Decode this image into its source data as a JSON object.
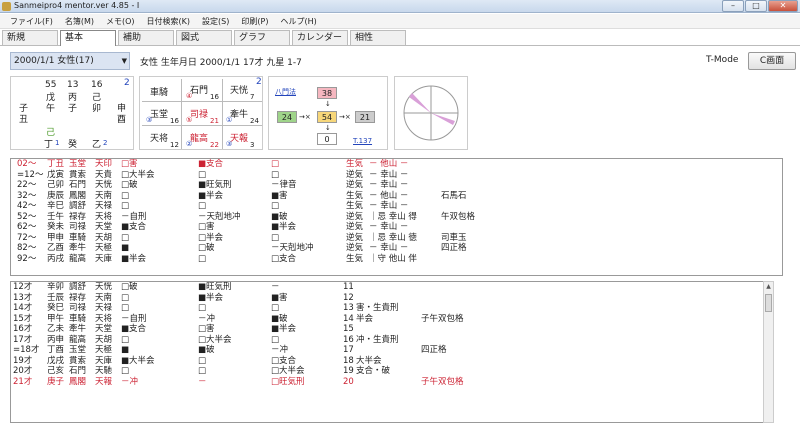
{
  "window": {
    "title": "Sanmeipro4 mentor.ver 4.85 - I"
  },
  "menu": [
    "ファイル(F)",
    "名簿(M)",
    "メモ(O)",
    "日付検索(K)",
    "設定(S)",
    "印刷(P)",
    "ヘルプ(H)"
  ],
  "tabs": [
    "新規",
    "基本",
    "補助",
    "図式",
    "グラフ",
    "カレンダー",
    "相性"
  ],
  "active_tab": "基本",
  "info": {
    "date_select": "2000/1/1 女性(17)",
    "summary": "女性 生年月日 2000/1/1 17才 九星 1-7",
    "tmode": "T-Mode",
    "c_button": "C画面"
  },
  "meishiki": {
    "top_nums": [
      "55",
      "13",
      "16"
    ],
    "top_marker": "2",
    "heaven": [
      "戊",
      "丙",
      "己"
    ],
    "earth": [
      "子",
      "午",
      "子",
      "卯"
    ],
    "earth_extra": "丑",
    "earth_right": "申",
    "earth_right2": "酉",
    "green": "己",
    "zoukan": [
      "丁",
      "癸",
      "乙"
    ],
    "zoukan_nums": [
      "1",
      "",
      "2"
    ]
  },
  "jintai": {
    "cells": [
      [
        "車騎",
        "石門",
        "天恍"
      ],
      [
        "玉堂",
        "司禄",
        "牽牛"
      ],
      [
        "天将",
        "龍高",
        "天報"
      ]
    ],
    "nums": [
      [
        "",
        "16",
        "7"
      ],
      [
        "16",
        "21",
        "24"
      ],
      [
        "12",
        "22",
        "3"
      ]
    ],
    "circles": [
      [
        "",
        "④",
        ""
      ],
      [
        "③",
        "⑤",
        "①"
      ],
      [
        "",
        "②",
        "③"
      ]
    ],
    "marker": "2"
  },
  "hachimon": {
    "label": "八門法",
    "top": "38",
    "left": "24",
    "center": "54",
    "right": "21",
    "bottom": "0",
    "total": "T.137"
  },
  "list1": [
    [
      "02～",
      "丁丑",
      "玉堂",
      "天印",
      "□害",
      "■支合",
      "□",
      "生気",
      "－ 他山 －",
      true
    ],
    [
      "=12～",
      "戊寅",
      "貫索",
      "天貴",
      "□大半会",
      "□",
      "□",
      "逆気",
      "－ 幸山 －",
      false
    ],
    [
      "22～",
      "己卯",
      "石門",
      "天恍",
      "□破",
      "■旺気刑",
      "－律音",
      "逆気",
      "－ 幸山 －",
      false
    ],
    [
      "32～",
      "庚辰",
      "鳳閣",
      "天南",
      "□",
      "■半会",
      "■害",
      "生気",
      "－ 他山 －",
      false
    ],
    [
      "42～",
      "辛巳",
      "調舒",
      "天禄",
      "□",
      "□",
      "□",
      "生気",
      "－ 幸山 －",
      false
    ],
    [
      "52～",
      "壬午",
      "禄存",
      "天将",
      "－自刑",
      "－天剋地冲",
      "■破",
      "逆気",
      "｜忌 幸山 得",
      false
    ],
    [
      "62～",
      "癸未",
      "司禄",
      "天堂",
      "■支合",
      "□害",
      "■半会",
      "逆気",
      "－ 幸山 －",
      false
    ],
    [
      "72～",
      "甲申",
      "車騎",
      "天胡",
      "□",
      "□半会",
      "□",
      "逆気",
      "｜忌 幸山 徳",
      false
    ],
    [
      "82～",
      "乙酉",
      "牽牛",
      "天極",
      "■",
      "□破",
      "－天剋地冲",
      "逆気",
      "－ 幸山 －",
      false
    ],
    [
      "92～",
      "丙戌",
      "龍高",
      "天庫",
      "■半会",
      "□",
      "□支合",
      "生気",
      "｜守 他山 伴",
      false
    ]
  ],
  "list1_extra": [
    "",
    "",
    "",
    "石馬石",
    "",
    "午双包格",
    "",
    "司車玉",
    "四正格",
    ""
  ],
  "list2": [
    [
      "12才",
      "辛卯",
      "調舒",
      "天恍",
      "□破",
      "■旺気刑",
      "－",
      "11",
      "",
      false
    ],
    [
      "13才",
      "壬辰",
      "禄存",
      "天南",
      "□",
      "■半会",
      "■害",
      "12",
      "",
      false
    ],
    [
      "14才",
      "癸巳",
      "司禄",
      "天禄",
      "□",
      "□",
      "□",
      "13",
      "害・生貴刑",
      false
    ],
    [
      "15才",
      "甲午",
      "車騎",
      "天将",
      "－自刑",
      "－冲",
      "■破",
      "14",
      "半会",
      false
    ],
    [
      "16才",
      "乙未",
      "牽牛",
      "天堂",
      "■支合",
      "□害",
      "■半会",
      "15",
      "",
      false
    ],
    [
      "17才",
      "丙申",
      "龍高",
      "天胡",
      "□",
      "□大半会",
      "□",
      "16",
      "冲・生貴刑",
      false
    ],
    [
      "=18才",
      "丁酉",
      "玉堂",
      "天極",
      "■",
      "■破",
      "－冲",
      "17",
      "",
      false
    ],
    [
      "19才",
      "戊戌",
      "貫索",
      "天庫",
      "■大半会",
      "□",
      "□支合",
      "18",
      "大半会",
      false
    ],
    [
      "20才",
      "己亥",
      "石門",
      "天馳",
      "□",
      "□",
      "□大半会",
      "19",
      "支合・破",
      false
    ],
    [
      "21才",
      "庚子",
      "鳳閣",
      "天報",
      "－冲",
      "－",
      "□旺気刑",
      "20",
      "",
      true
    ]
  ],
  "list2_extra": [
    "",
    "",
    "",
    "子午双包格",
    "",
    "",
    "四正格",
    "",
    "",
    "子午双包格"
  ]
}
